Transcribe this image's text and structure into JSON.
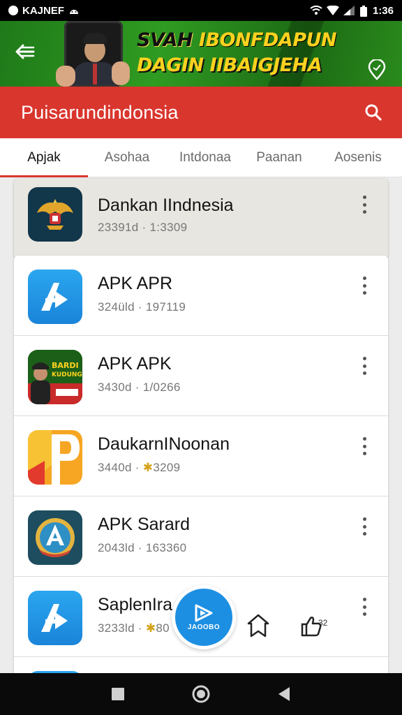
{
  "status_bar": {
    "left_text": "KAJNEF",
    "time": "1:36"
  },
  "banner": {
    "line1_a": "SVAH ",
    "line1_b": "IBONFDAPUN",
    "line2": "DAGIN IIBAIGJEHA"
  },
  "app_bar": {
    "title": "Puisarundindonsia"
  },
  "tabs": [
    {
      "label": "Apjak",
      "active": true
    },
    {
      "label": "Asohaa",
      "active": false
    },
    {
      "label": "Intdonaa",
      "active": false
    },
    {
      "label": "Paanan",
      "active": false
    },
    {
      "label": "Aosenis",
      "active": false
    }
  ],
  "featured": {
    "name": "Dankan IIndnesia",
    "meta_a": "23391d · ",
    "meta_b": "1:3309",
    "icon": "garuda-emblem-icon"
  },
  "apps": [
    {
      "name": "APK APR",
      "meta_a": "324üld · ",
      "meta_b": "197119",
      "icon": "blue-a-logo-icon"
    },
    {
      "name": "APK APK",
      "meta_a": "3430d · ",
      "meta_b": "1/0266",
      "icon": "poster-app-icon"
    },
    {
      "name": "DaukarnINoonan",
      "meta_a": "3440d · ",
      "meta_b": "3209",
      "star": "✱",
      "icon": "orange-p-logo-icon"
    },
    {
      "name": "APK Sarard",
      "meta_a": "2043ld · ",
      "meta_b": "163360",
      "icon": "shield-a-logo-icon"
    },
    {
      "name": "SaplenIra",
      "meta_a": "3233ld · ",
      "meta_b": "80",
      "star": "✱",
      "icon": "blue-a-logo-icon"
    }
  ],
  "fab": {
    "label": "JAOOBO"
  },
  "bottom": {
    "count": "32"
  },
  "colors": {
    "accent_red": "#d9362e",
    "banner_green": "#2f9b21",
    "fab_blue": "#1d8fe2"
  }
}
